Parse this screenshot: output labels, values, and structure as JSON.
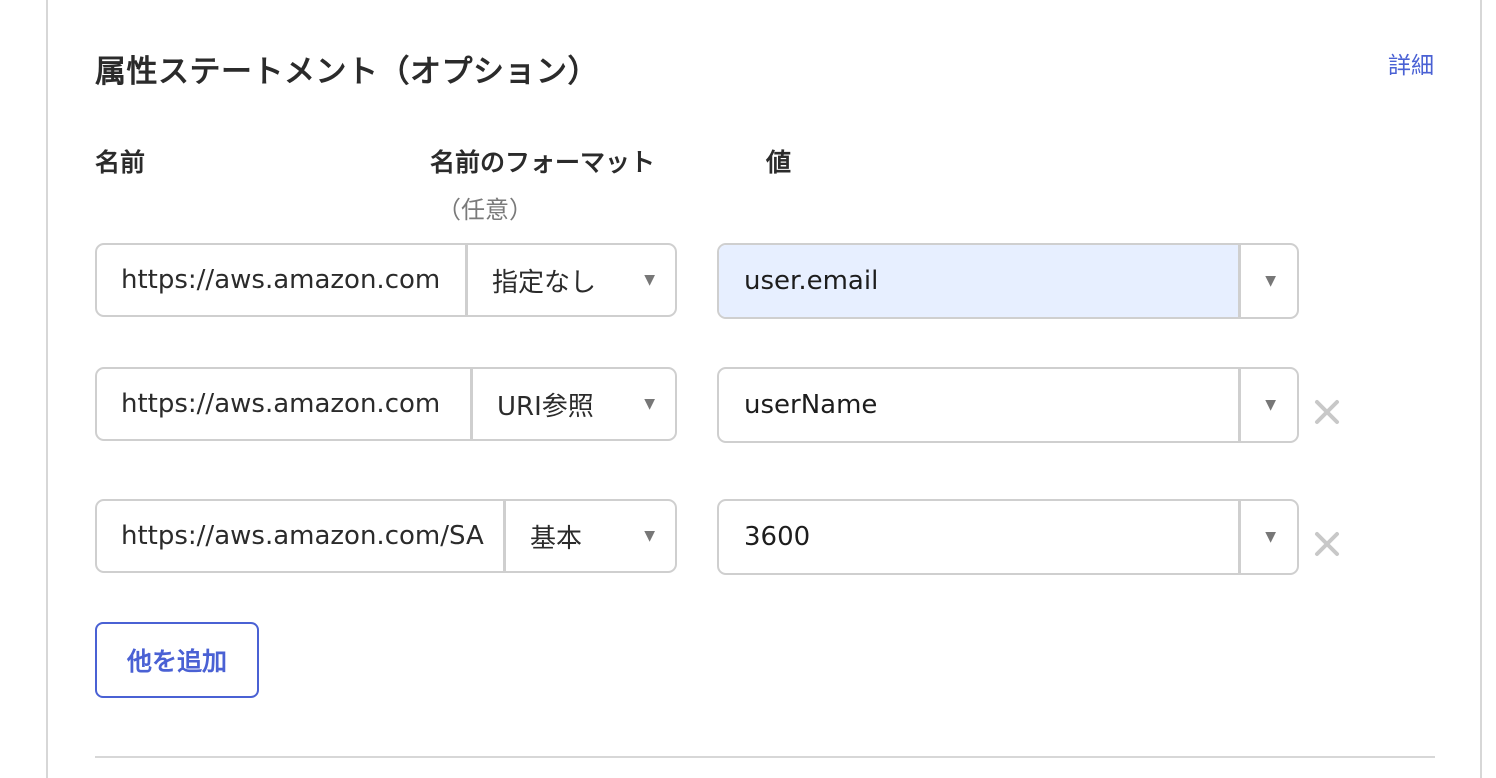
{
  "section": {
    "title": "属性ステートメント（オプション）",
    "details_link": "詳細"
  },
  "columns": {
    "name": "名前",
    "name_format": "名前のフォーマット",
    "name_format_sub": "（任意）",
    "value": "値"
  },
  "rows": [
    {
      "name": "https://aws.amazon.com",
      "format": "指定なし",
      "value": "user.email",
      "removable": false,
      "value_highlighted": true
    },
    {
      "name": "https://aws.amazon.com",
      "format": "URI参照",
      "value": "userName",
      "removable": true
    },
    {
      "name": "https://aws.amazon.com/SA",
      "format": "基本",
      "value": "3600",
      "removable": true
    }
  ],
  "add_button": "他を追加",
  "colors": {
    "accent": "#4a61d4",
    "highlight_bg": "#e7efff",
    "border": "#cfcfcf"
  },
  "icons": {
    "dropdown": "chevron-down-icon",
    "remove": "close-icon"
  }
}
